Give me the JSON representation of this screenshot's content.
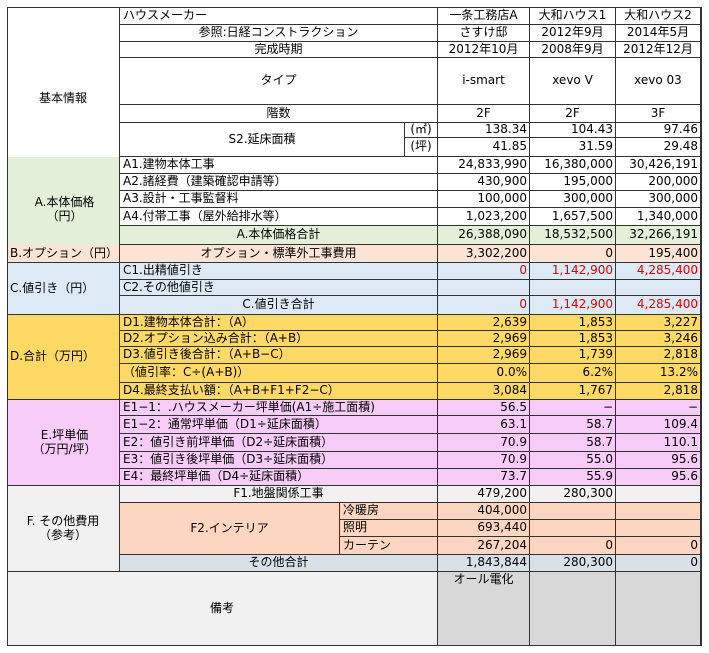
{
  "colors": {
    "green": "#e3efd9",
    "orange": "#fbe4d5",
    "blue": "#dde9f5",
    "gold": "#fed966",
    "pink": "#f8ccf8",
    "lightgray": "#f1f1f1",
    "gray": "#d8d8d8",
    "bluegray": "#dae0e8",
    "peach": "#fcd6c0",
    "red": "#e00000"
  },
  "header": {
    "col_label": "ハウスメーカー",
    "ref_label": "参照:日経コンストラクション",
    "date_label": "完成時期",
    "type_label": "タイプ",
    "floors_label": "階数",
    "area_label": "S2.延床面積",
    "unit_m2": "(㎡)",
    "unit_tsubo": "(坪)",
    "section": "基本情報",
    "makers": [
      {
        "name": "一条工務店A",
        "ref": "さすけ邸",
        "date": "2012年10月",
        "type": "i-smart",
        "floors": "2F",
        "area_m2": "138.34",
        "area_tsubo": "41.85"
      },
      {
        "name": "大和ハウス1",
        "ref": "",
        "date": "2012年9月",
        "date2": "2008年9月",
        "type": "xevo V",
        "floors": "2F",
        "area_m2": "104.43",
        "area_tsubo": "31.59"
      },
      {
        "name": "大和ハウス2",
        "ref": "",
        "date": "2014年5月",
        "date2": "2012年12月",
        "type": "xevo 03",
        "floors": "3F",
        "area_m2": "97.46",
        "area_tsubo": "29.48"
      }
    ]
  },
  "sectionA": {
    "title": "A.本体価格\n（円）",
    "rows": [
      {
        "label": "A1.建物本体工事",
        "v": [
          "24,833,990",
          "16,380,000",
          "30,426,191"
        ]
      },
      {
        "label": "A2.諸経費（建築確認申請等）",
        "v": [
          "430,900",
          "195,000",
          "200,000"
        ]
      },
      {
        "label": "A3.設計・工事監督料",
        "v": [
          "100,000",
          "300,000",
          "300,000"
        ]
      },
      {
        "label": "A4.付帯工事（屋外給排水等）",
        "v": [
          "1,023,200",
          "1,657,500",
          "1,340,000"
        ]
      }
    ],
    "total_label": "A.本体価格合計",
    "total": [
      "26,388,090",
      "18,532,500",
      "32,266,191"
    ]
  },
  "sectionB": {
    "title": "B.オプション（円）",
    "label": "オプション・標準外工事費用",
    "v": [
      "3,302,200",
      "0",
      "195,400"
    ]
  },
  "sectionC": {
    "title": "C.値引き（円）",
    "rows": [
      {
        "label": "C1.出精値引き",
        "v": [
          "0",
          "1,142,900",
          "4,285,400"
        ]
      },
      {
        "label": "C2.その他値引き",
        "v": [
          "",
          "",
          ""
        ]
      }
    ],
    "total_label": "C.値引き合計",
    "total": [
      "0",
      "1,142,900",
      "4,285,400"
    ]
  },
  "sectionD": {
    "title": "D.合計（万円）",
    "rows": [
      {
        "label": "D1.建物本体合計：（A）",
        "v": [
          "2,639",
          "1,853",
          "3,227"
        ]
      },
      {
        "label": "D2.オプション込み合計：（A+B）",
        "v": [
          "2,969",
          "1,853",
          "3,246"
        ]
      },
      {
        "label": "D3.値引き後合計：（A+B−C）",
        "v": [
          "2,969",
          "1,739",
          "2,818"
        ]
      },
      {
        "label": "（値引率：C÷(A+B)）",
        "v": [
          "0.0%",
          "6.2%",
          "13.2%"
        ]
      },
      {
        "label": "D4.最終支払い額：（A+B+F1+F2−C）",
        "v": [
          "3,084",
          "1,767",
          "2,818"
        ]
      }
    ]
  },
  "sectionE": {
    "title": "E.坪単価\n（万円/坪）",
    "rows": [
      {
        "label": "E1−1：.ハウスメーカー坪単価(A1÷施工面積)",
        "v": [
          "56.5",
          "−",
          "−"
        ]
      },
      {
        "label": "E1−2：通常坪単価（D1÷延床面積）",
        "v": [
          "63.1",
          "58.7",
          "109.4"
        ]
      },
      {
        "label": "E2：値引き前坪単価（D2÷延床面積）",
        "v": [
          "70.9",
          "58.7",
          "110.1"
        ]
      },
      {
        "label": "E3：値引き後坪単価（D3÷延床面積）",
        "v": [
          "70.9",
          "55.0",
          "95.6"
        ]
      },
      {
        "label": "E4：最終坪単価（D4÷延床面積）",
        "v": [
          "73.7",
          "55.9",
          "95.6"
        ]
      }
    ]
  },
  "sectionF": {
    "title": "F. その他費用\n（参考）",
    "f1_label": "F1.地盤関係工事",
    "f1": [
      "479,200",
      "280,300",
      ""
    ],
    "f2_label": "F2.インテリア",
    "f2_rows": [
      {
        "label": "冷暖房",
        "v": [
          "404,000",
          "",
          ""
        ]
      },
      {
        "label": "照明",
        "v": [
          "693,440",
          "",
          ""
        ]
      },
      {
        "label": "カーテン",
        "v": [
          "267,204",
          "0",
          "0"
        ]
      }
    ],
    "total_label": "その他合計",
    "total": [
      "1,843,844",
      "280,300",
      "0"
    ]
  },
  "notes": {
    "title": "備考",
    "v": [
      "オール電化",
      "",
      ""
    ]
  }
}
